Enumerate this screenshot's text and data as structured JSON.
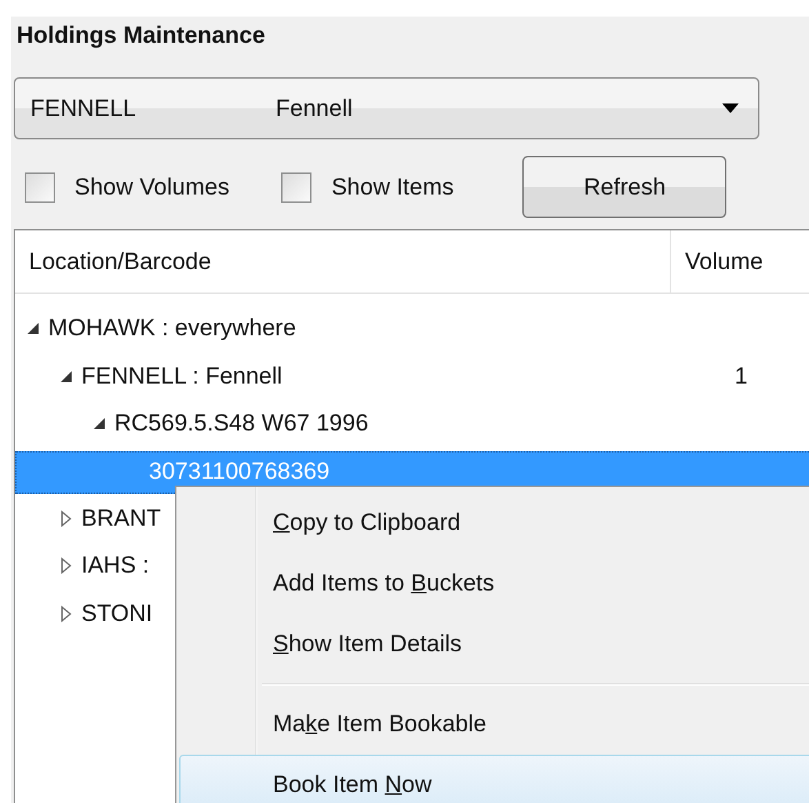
{
  "title": "Holdings Maintenance",
  "location_select": {
    "code": "FENNELL",
    "name": "Fennell"
  },
  "checkboxes": [
    {
      "label": "Show Volumes",
      "checked": false
    },
    {
      "label": "Show Items",
      "checked": false
    }
  ],
  "refresh_button": "Refresh",
  "table": {
    "columns": [
      "Location/Barcode",
      "Volume"
    ],
    "rows": [
      {
        "label": "MOHAWK : everywhere",
        "expanded": true,
        "selected": false,
        "children": [
          {
            "label": "FENNELL : Fennell",
            "volumes": "1",
            "expanded": true,
            "selected": false,
            "children": [
              {
                "label": "RC569.5.S48 W67 1996",
                "expanded": true,
                "selected": false,
                "children": [
                  {
                    "label": "30731100768369",
                    "selected": true
                  }
                ]
              }
            ]
          },
          {
            "label": "BRANT",
            "expanded": false,
            "selected": false
          },
          {
            "label": "IAHS :",
            "expanded": false,
            "selected": false
          },
          {
            "label": "STONI",
            "expanded": false,
            "selected": false
          }
        ]
      }
    ]
  },
  "context_menu": [
    {
      "kind": "item",
      "parts": {
        "key": "C",
        "after": "opy to Clipboard"
      },
      "highlighted": false
    },
    {
      "kind": "item",
      "parts": {
        "before": "Add Items to ",
        "key": "B",
        "after": "uckets"
      },
      "highlighted": false
    },
    {
      "kind": "item",
      "parts": {
        "key": "S",
        "after": "how Item Details"
      },
      "highlighted": false
    },
    {
      "kind": "separator"
    },
    {
      "kind": "item",
      "parts": {
        "before": "Ma",
        "key": "k",
        "after": "e Item Bookable"
      },
      "highlighted": false
    },
    {
      "kind": "item",
      "parts": {
        "before": "Book Item ",
        "key": "N",
        "after": "ow"
      },
      "highlighted": true
    }
  ]
}
